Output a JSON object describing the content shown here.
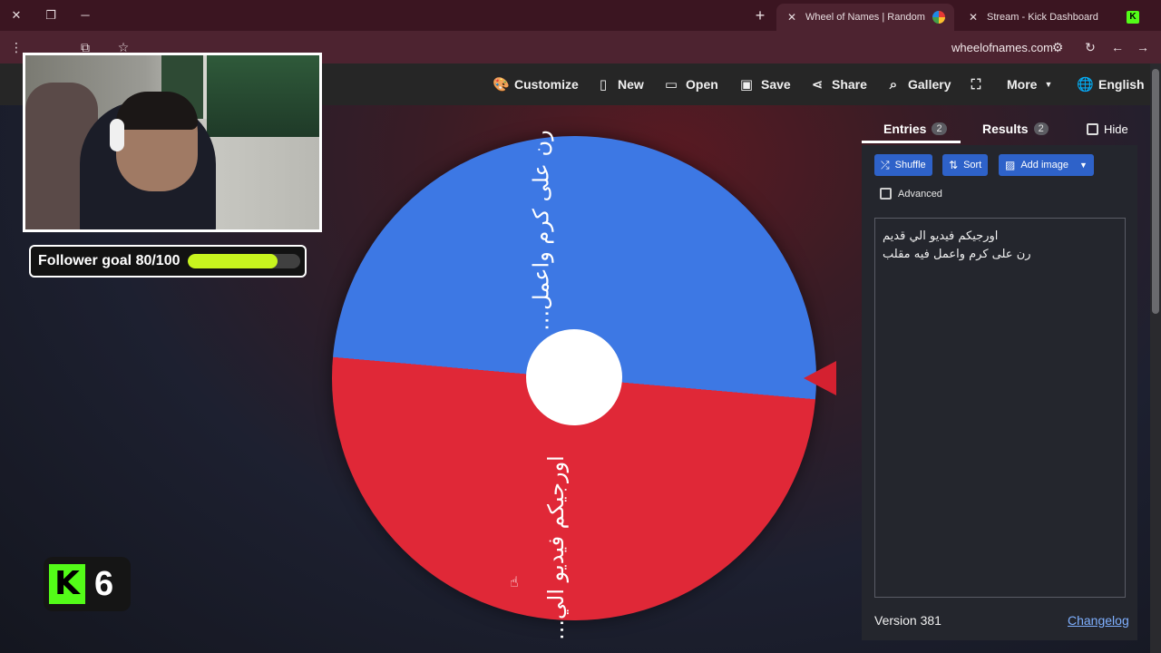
{
  "browser": {
    "tabs": [
      {
        "title": "Wheel of Names | Random nam",
        "active": true
      },
      {
        "title": "Stream - Kick Dashboard",
        "active": false
      }
    ],
    "url": "wheelofnames.com"
  },
  "nav": {
    "customize": "Customize",
    "new": "New",
    "open": "Open",
    "save": "Save",
    "share": "Share",
    "gallery": "Gallery",
    "more": "More",
    "language": "English"
  },
  "overlay": {
    "follower_goal": "Follower goal 80/100",
    "follower_progress": 0.8,
    "kick_count": "6"
  },
  "wheel": {
    "segments": [
      {
        "label": "...رن على كرم واعمل",
        "color": "#e02837"
      },
      {
        "label": "...اورجيكم فيديو الي",
        "color": "#3d78e4"
      }
    ]
  },
  "panel": {
    "tab_entries": "Entries",
    "entries_count": "2",
    "tab_results": "Results",
    "results_count": "2",
    "hide": "Hide",
    "shuffle": "Shuffle",
    "sort": "Sort",
    "add_image": "Add image",
    "advanced": "Advanced",
    "entries": [
      "اورجيكم فيديو الي قديم",
      "رن على كرم واعمل فيه مقلب"
    ],
    "version": "Version 381",
    "changelog": "Changelog"
  },
  "colors": {
    "accent": "#2e62c9",
    "wheel_red": "#e02837",
    "wheel_blue": "#3d78e4",
    "kick_green": "#53fc18"
  }
}
